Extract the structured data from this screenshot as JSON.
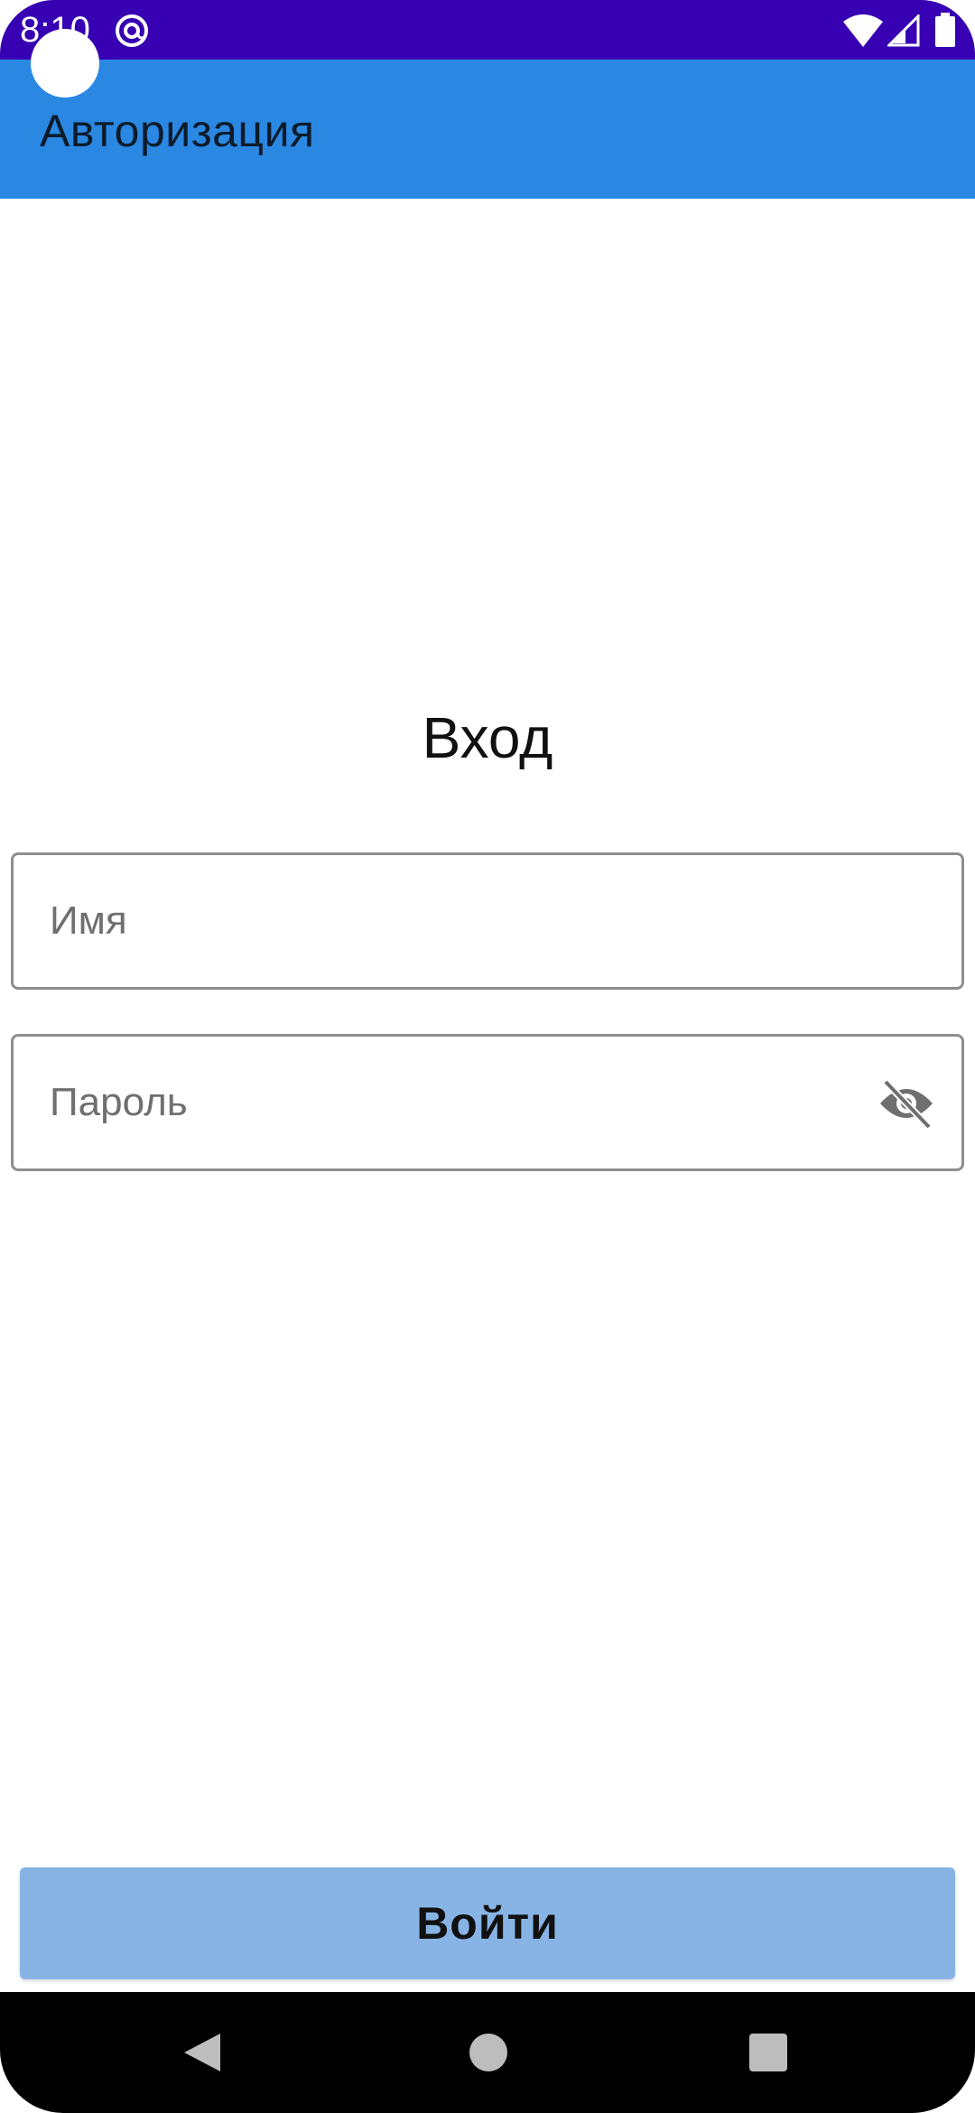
{
  "status_bar": {
    "time": "8:10",
    "background": "#3700b3"
  },
  "app_bar": {
    "title": "Авторизация",
    "background": "#2a88e3"
  },
  "form": {
    "heading": "Вход",
    "name_placeholder": "Имя",
    "name_value": "",
    "password_placeholder": "Пароль",
    "password_value": "",
    "password_toggle_icon": "eye-off-icon"
  },
  "login_button": {
    "label": "Войти",
    "background": "#87b4e5"
  },
  "nav_bar": {
    "icons": [
      "back-icon",
      "home-icon",
      "recents-icon"
    ]
  }
}
